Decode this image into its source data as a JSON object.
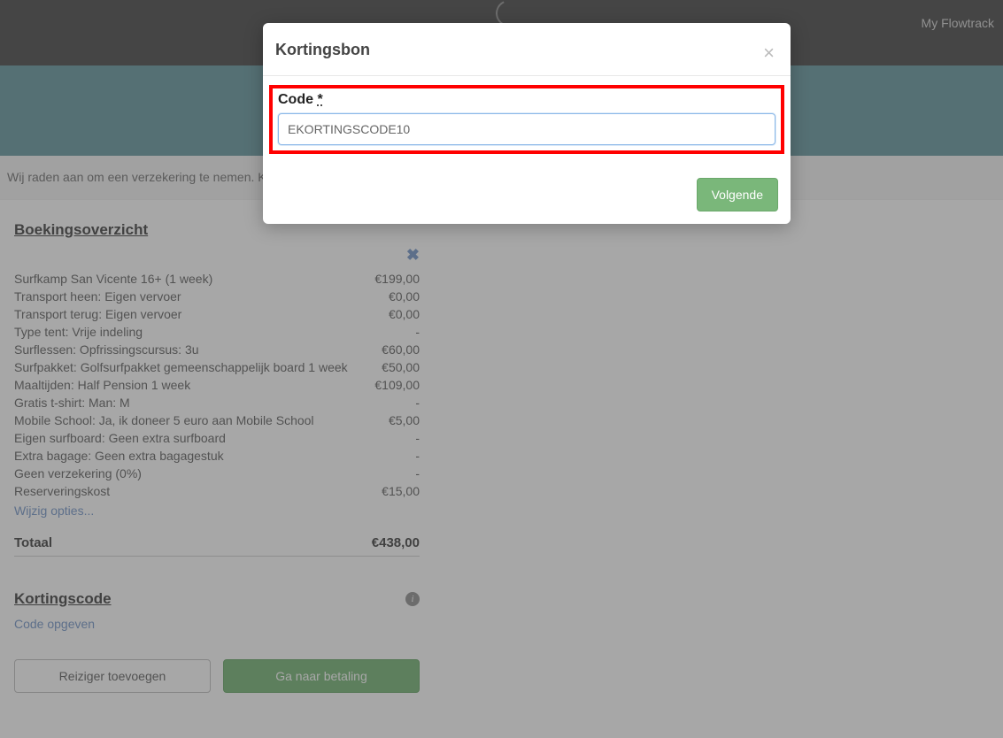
{
  "header": {
    "link": "My Flowtrack"
  },
  "insurance_notice": "Wij raden aan om een verzekering te nemen. K",
  "overview": {
    "title": "Boekingsoverzicht",
    "items": [
      {
        "label": "Surfkamp San Vicente 16+ (1 week)",
        "price": "€199,00"
      },
      {
        "label": "Transport heen: Eigen vervoer",
        "price": "€0,00"
      },
      {
        "label": "Transport terug: Eigen vervoer",
        "price": "€0,00"
      },
      {
        "label": "Type tent: Vrije indeling",
        "price": "-"
      },
      {
        "label": "Surflessen: Opfrissingscursus: 3u",
        "price": "€60,00"
      },
      {
        "label": "Surfpakket: Golfsurfpakket gemeenschappelijk board 1 week",
        "price": "€50,00"
      },
      {
        "label": "Maaltijden: Half Pension 1 week",
        "price": "€109,00"
      },
      {
        "label": "Gratis t-shirt: Man: M",
        "price": "-"
      },
      {
        "label": "Mobile School: Ja, ik doneer 5 euro aan Mobile School",
        "price": "€5,00"
      },
      {
        "label": "Eigen surfboard: Geen extra surfboard",
        "price": "-"
      },
      {
        "label": "Extra bagage: Geen extra bagagestuk",
        "price": "-"
      },
      {
        "label": "Geen verzekering (0%)",
        "price": "-"
      },
      {
        "label": "Reserveringskost",
        "price": "€15,00"
      }
    ],
    "change_link": "Wijzig opties...",
    "total_label": "Totaal",
    "total_value": "€438,00"
  },
  "discount": {
    "title": "Kortingscode",
    "link": "Code opgeven"
  },
  "buttons": {
    "add_traveler": "Reiziger toevoegen",
    "go_pay": "Ga naar betaling"
  },
  "modal": {
    "title": "Kortingsbon",
    "code_label": "Code",
    "required_marker": "*",
    "code_value": "EKORTINGSCODE10",
    "next": "Volgende"
  }
}
